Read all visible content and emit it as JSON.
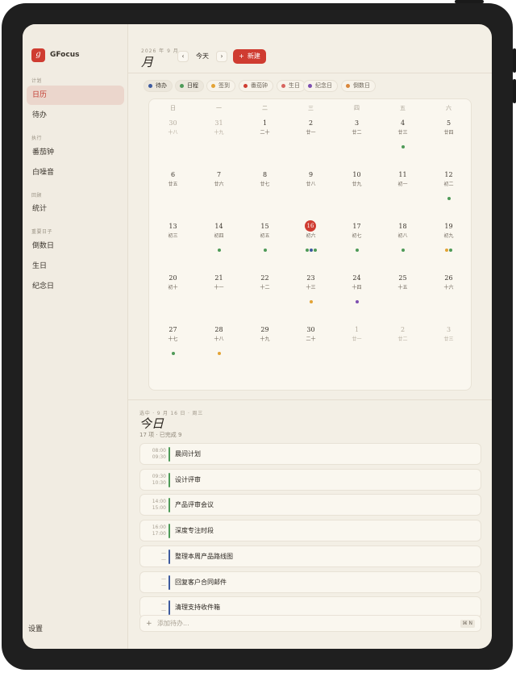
{
  "app": {
    "name": "GFocus",
    "logo_letter": "g"
  },
  "colors": {
    "accent": "#cf3c31",
    "todo": "#3d5a9e",
    "event": "#4e9a58",
    "checkin": "#e3a335",
    "pomodoro": "#cf3c31",
    "birthday": "#d7655f",
    "memorial": "#7d4fb0",
    "countdown": "#d9863a"
  },
  "sidebar": {
    "sections": [
      {
        "label": "计划",
        "items": [
          "日历",
          "待办"
        ]
      },
      {
        "label": "执行",
        "items": [
          "番茄钟",
          "白噪音"
        ]
      },
      {
        "label": "回顾",
        "items": [
          "统计"
        ]
      },
      {
        "label": "重要日子",
        "items": [
          "倒数日",
          "生日",
          "纪念日"
        ]
      }
    ],
    "active": "日历",
    "settings": "设置"
  },
  "header": {
    "subtitle": "2026 年 9 月",
    "title": "月",
    "prev_icon": "‹",
    "next_icon": "›",
    "today": "今天",
    "new_button": "新建",
    "new_icon": "+"
  },
  "filters": [
    {
      "label": "待办",
      "color": "#3d5a9e",
      "active": true
    },
    {
      "label": "日程",
      "color": "#4e9a58",
      "active": true
    },
    {
      "label": "签到",
      "color": "#e3a335",
      "active": false
    },
    {
      "label": "番茄钟",
      "color": "#cf3c31",
      "active": false
    },
    {
      "label": "生日",
      "color": "#d7655f",
      "active": false
    },
    {
      "label": "纪念日",
      "color": "#7d4fb0",
      "active": false
    },
    {
      "label": "倒数日",
      "color": "#d9863a",
      "active": false
    }
  ],
  "calendar": {
    "weekdays": [
      "日",
      "一",
      "二",
      "三",
      "四",
      "五",
      "六"
    ],
    "weeks": [
      [
        {
          "d": "30",
          "l": "十八",
          "m": true,
          "dots": []
        },
        {
          "d": "31",
          "l": "十九",
          "m": true,
          "dots": []
        },
        {
          "d": "1",
          "l": "二十",
          "dots": []
        },
        {
          "d": "2",
          "l": "廿一",
          "dots": []
        },
        {
          "d": "3",
          "l": "廿二",
          "dots": []
        },
        {
          "d": "4",
          "l": "廿三",
          "dots": [
            "#4e9a58"
          ]
        },
        {
          "d": "5",
          "l": "廿四",
          "dots": []
        }
      ],
      [
        {
          "d": "6",
          "l": "廿五",
          "dots": []
        },
        {
          "d": "7",
          "l": "廿六",
          "dots": []
        },
        {
          "d": "8",
          "l": "廿七",
          "dots": []
        },
        {
          "d": "9",
          "l": "廿八",
          "dots": []
        },
        {
          "d": "10",
          "l": "廿九",
          "dots": []
        },
        {
          "d": "11",
          "l": "初一",
          "dots": []
        },
        {
          "d": "12",
          "l": "初二",
          "dots": [
            "#4e9a58"
          ]
        }
      ],
      [
        {
          "d": "13",
          "l": "初三",
          "dots": []
        },
        {
          "d": "14",
          "l": "初四",
          "dots": [
            "#4e9a58"
          ]
        },
        {
          "d": "15",
          "l": "初五",
          "dots": [
            "#4e9a58"
          ]
        },
        {
          "d": "16",
          "l": "初六",
          "today": true,
          "dots": [
            "#4e9a58",
            "#3d5a9e",
            "#4e9a58"
          ]
        },
        {
          "d": "17",
          "l": "初七",
          "dots": [
            "#4e9a58"
          ]
        },
        {
          "d": "18",
          "l": "初八",
          "dots": [
            "#4e9a58"
          ]
        },
        {
          "d": "19",
          "l": "初九",
          "dots": [
            "#e3a335",
            "#4e9a58"
          ]
        }
      ],
      [
        {
          "d": "20",
          "l": "初十",
          "dots": []
        },
        {
          "d": "21",
          "l": "十一",
          "dots": []
        },
        {
          "d": "22",
          "l": "十二",
          "dots": []
        },
        {
          "d": "23",
          "l": "十三",
          "dots": [
            "#e3a335"
          ]
        },
        {
          "d": "24",
          "l": "十四",
          "dots": [
            "#7d4fb0"
          ]
        },
        {
          "d": "25",
          "l": "十五",
          "dots": []
        },
        {
          "d": "26",
          "l": "十六",
          "dots": []
        }
      ],
      [
        {
          "d": "27",
          "l": "十七",
          "dots": [
            "#4e9a58"
          ]
        },
        {
          "d": "28",
          "l": "十八",
          "dots": [
            "#e3a335"
          ]
        },
        {
          "d": "29",
          "l": "十九",
          "dots": []
        },
        {
          "d": "30",
          "l": "二十",
          "dots": []
        },
        {
          "d": "1",
          "l": "廿一",
          "m": true,
          "dots": []
        },
        {
          "d": "2",
          "l": "廿二",
          "m": true,
          "dots": []
        },
        {
          "d": "3",
          "l": "廿三",
          "m": true,
          "dots": []
        }
      ]
    ]
  },
  "day": {
    "subtitle": "选中 · 9 月 16 日 · 周三",
    "title": "今日",
    "count": "17 项 · 已完成 9",
    "tasks": [
      {
        "start": "08:00",
        "end": "09:30",
        "title": "晨间计划",
        "color": "#4e9a58"
      },
      {
        "start": "09:30",
        "end": "10:30",
        "title": "设计评审",
        "color": "#4e9a58"
      },
      {
        "start": "14:00",
        "end": "15:00",
        "title": "产品评审会议",
        "color": "#4e9a58"
      },
      {
        "start": "16:00",
        "end": "17:00",
        "title": "深度专注时段",
        "color": "#4e9a58"
      },
      {
        "start": "—",
        "end": "—",
        "title": "整理本周产品路线图",
        "color": "#3d5a9e"
      },
      {
        "start": "—",
        "end": "—",
        "title": "回复客户合同邮件",
        "color": "#3d5a9e"
      },
      {
        "start": "—",
        "end": "—",
        "title": "清理支持收件箱",
        "color": "#3d5a9e"
      }
    ],
    "add_placeholder": "添加待办...",
    "add_icon": "+",
    "shortcut": "⌘ N"
  }
}
